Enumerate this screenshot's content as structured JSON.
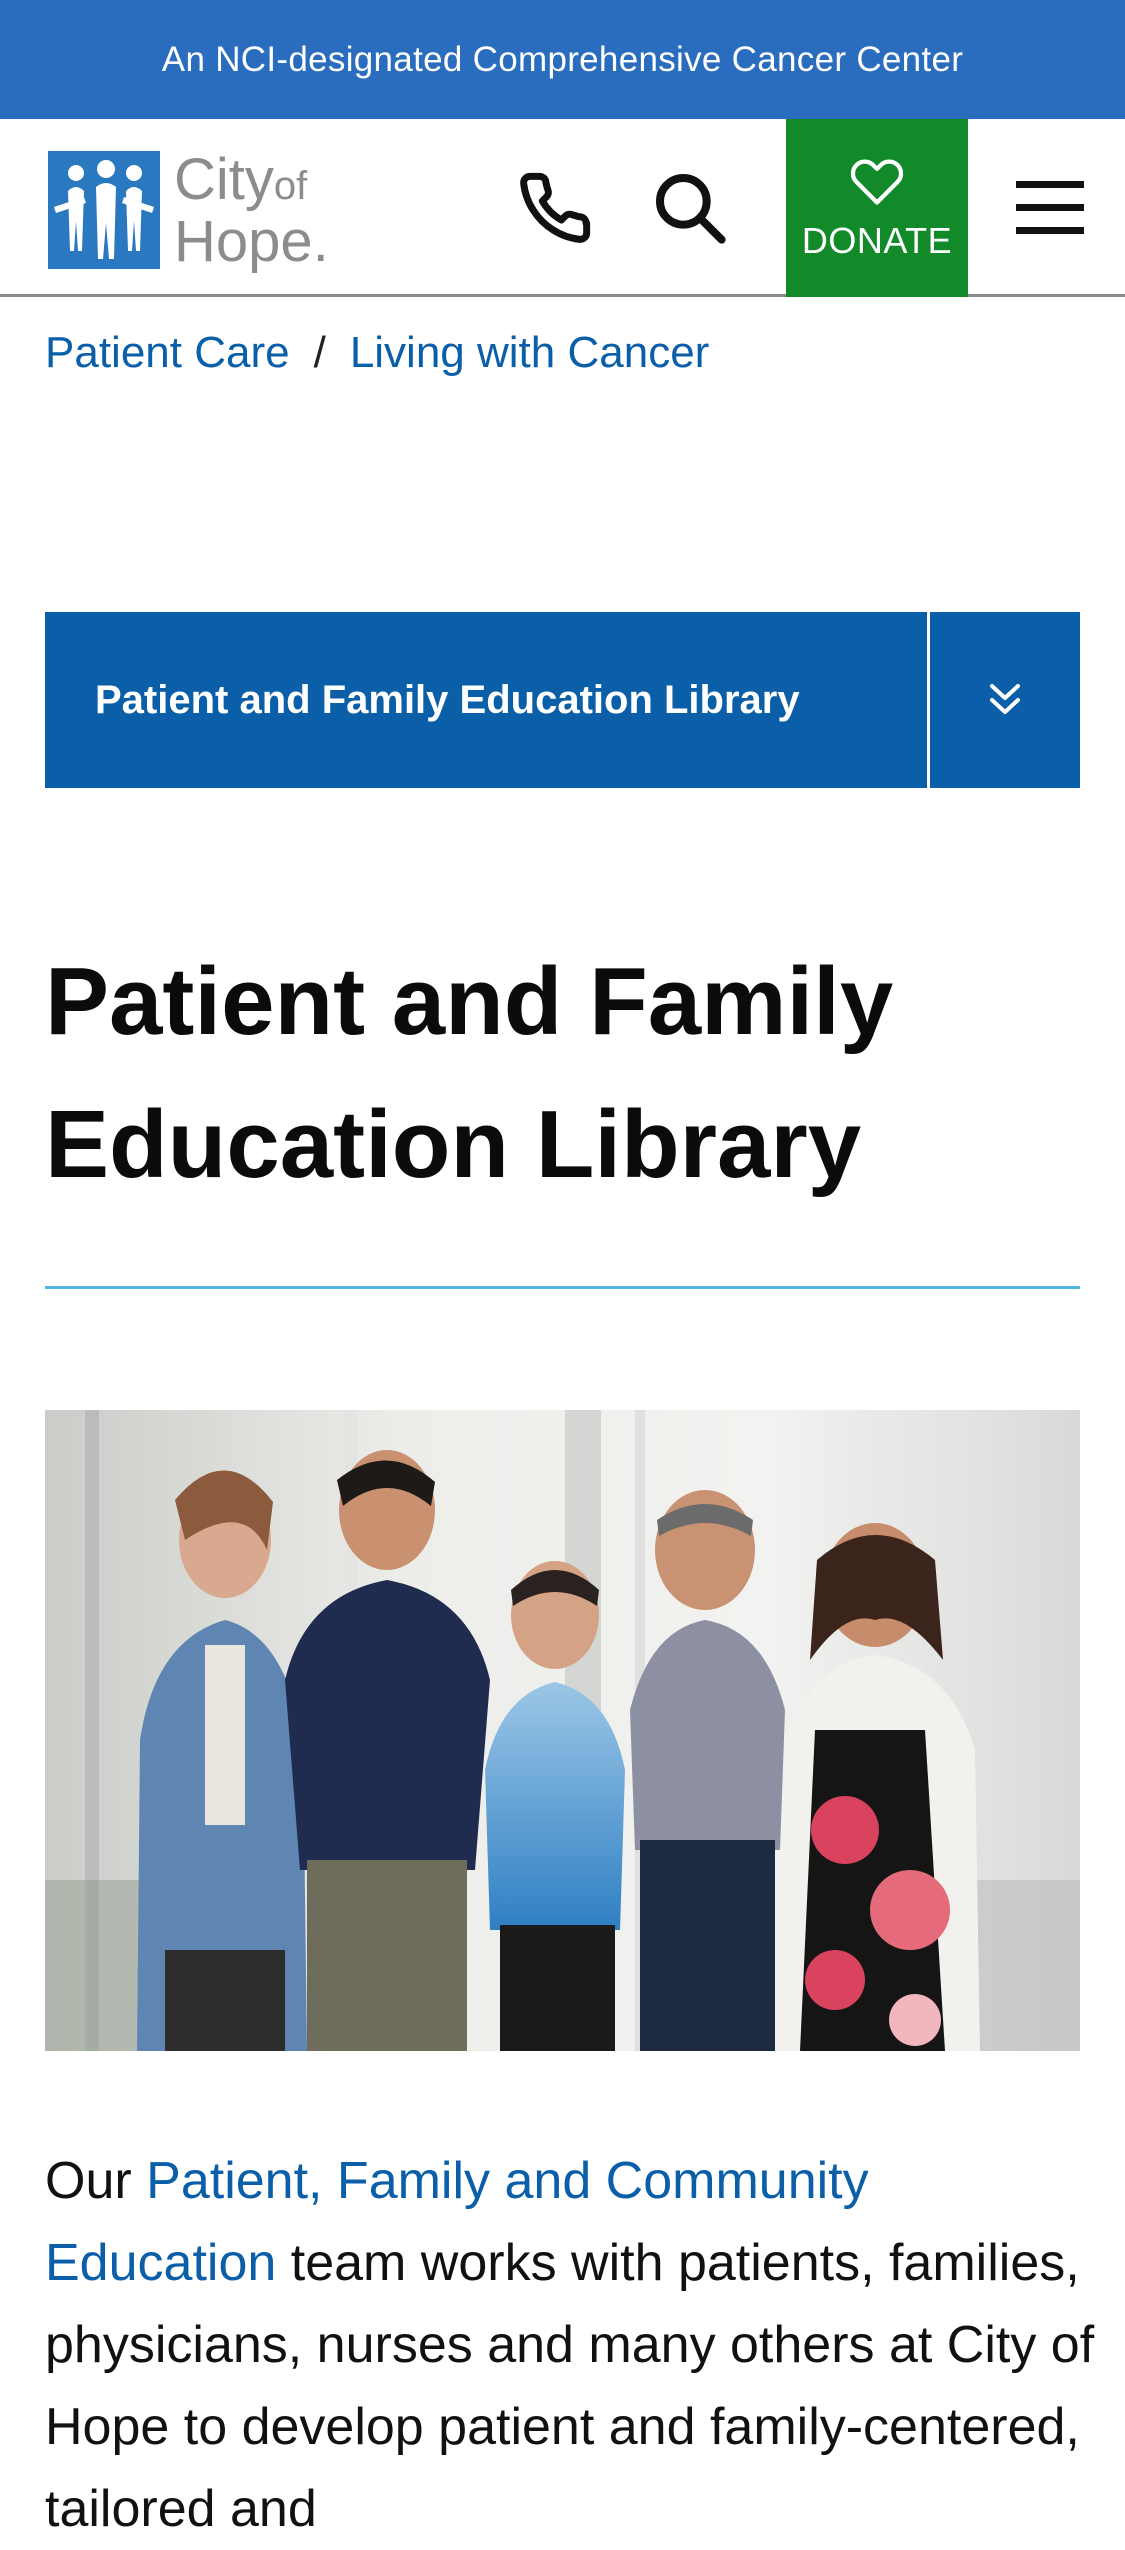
{
  "banner": {
    "text": "An NCI-designated Comprehensive Cancer Center"
  },
  "header": {
    "logo": {
      "line1": "City",
      "line1_small": "of",
      "line2": "Hope."
    },
    "donate_label": "DONATE",
    "icons": {
      "phone": "phone-icon",
      "search": "search-icon",
      "donate": "heart-icon",
      "menu": "hamburger-menu-icon"
    }
  },
  "breadcrumb": [
    {
      "label": "Patient Care"
    },
    {
      "label": "Living with Cancer"
    }
  ],
  "breadcrumb_separator": "/",
  "section_nav": {
    "label": "Patient and Family Education Library",
    "toggle_icon": "double-chevron-down-icon"
  },
  "page": {
    "title_line1": "Patient and Family",
    "title_line2": "Education Library"
  },
  "intro": {
    "prefix": "Our ",
    "link_text": "Patient, Family and Community Education",
    "rest": " team works with patients, families, physicians, nurses and many others at City of Hope to develop patient and family-centered, tailored and"
  },
  "colors": {
    "banner": "#2a6dbf",
    "primary_blue": "#0b5ea8",
    "donate_green": "#128a2a",
    "rule": "#4fb7e0"
  }
}
